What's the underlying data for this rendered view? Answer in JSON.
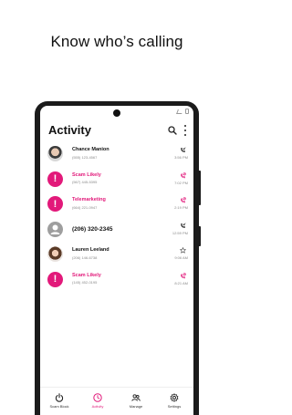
{
  "headline": "Know who’s calling",
  "app": {
    "title": "Activity"
  },
  "calls": [
    {
      "name": "Chance Manion",
      "number": "(555) 123-4567",
      "time": "3:56 PM",
      "type": "contact",
      "avatar": "photo-male",
      "status_icon": "incoming-call-icon"
    },
    {
      "name": "Scam Likely",
      "number": "(567) 445-5395",
      "time": "7:02 PM",
      "type": "scam",
      "avatar": "scam-alert",
      "status_icon": "blocked-call-icon"
    },
    {
      "name": "Telemarketing",
      "number": "(664) 221-0947",
      "time": "2:19 PM",
      "type": "scam",
      "avatar": "scam-alert",
      "status_icon": "blocked-call-icon"
    },
    {
      "name": "(206) 320-2345",
      "number": "",
      "time": "12:59 PM",
      "type": "unknown",
      "avatar": "unknown-person",
      "status_icon": "incoming-call-icon"
    },
    {
      "name": "Lauren Leeland",
      "number": "(206) 146-6738",
      "time": "9:06 AM",
      "type": "contact",
      "avatar": "photo-female",
      "status_icon": "star-icon"
    },
    {
      "name": "Scam Likely",
      "number": "(145) 452-0195",
      "time": "8:21 AM",
      "type": "scam",
      "avatar": "scam-alert",
      "status_icon": "blocked-call-icon"
    }
  ],
  "nav": [
    {
      "label": "Scam Block",
      "icon": "power-icon",
      "active": false
    },
    {
      "label": "Activity",
      "icon": "clock-icon",
      "active": true
    },
    {
      "label": "Manage",
      "icon": "people-icon",
      "active": false
    },
    {
      "label": "Settings",
      "icon": "gear-icon",
      "active": false
    }
  ],
  "colors": {
    "accent": "#e2197a",
    "unknown_avatar": "#9e9e9e",
    "secondary_text": "#8a8a8a",
    "phone_frame": "#1b1b1b"
  }
}
